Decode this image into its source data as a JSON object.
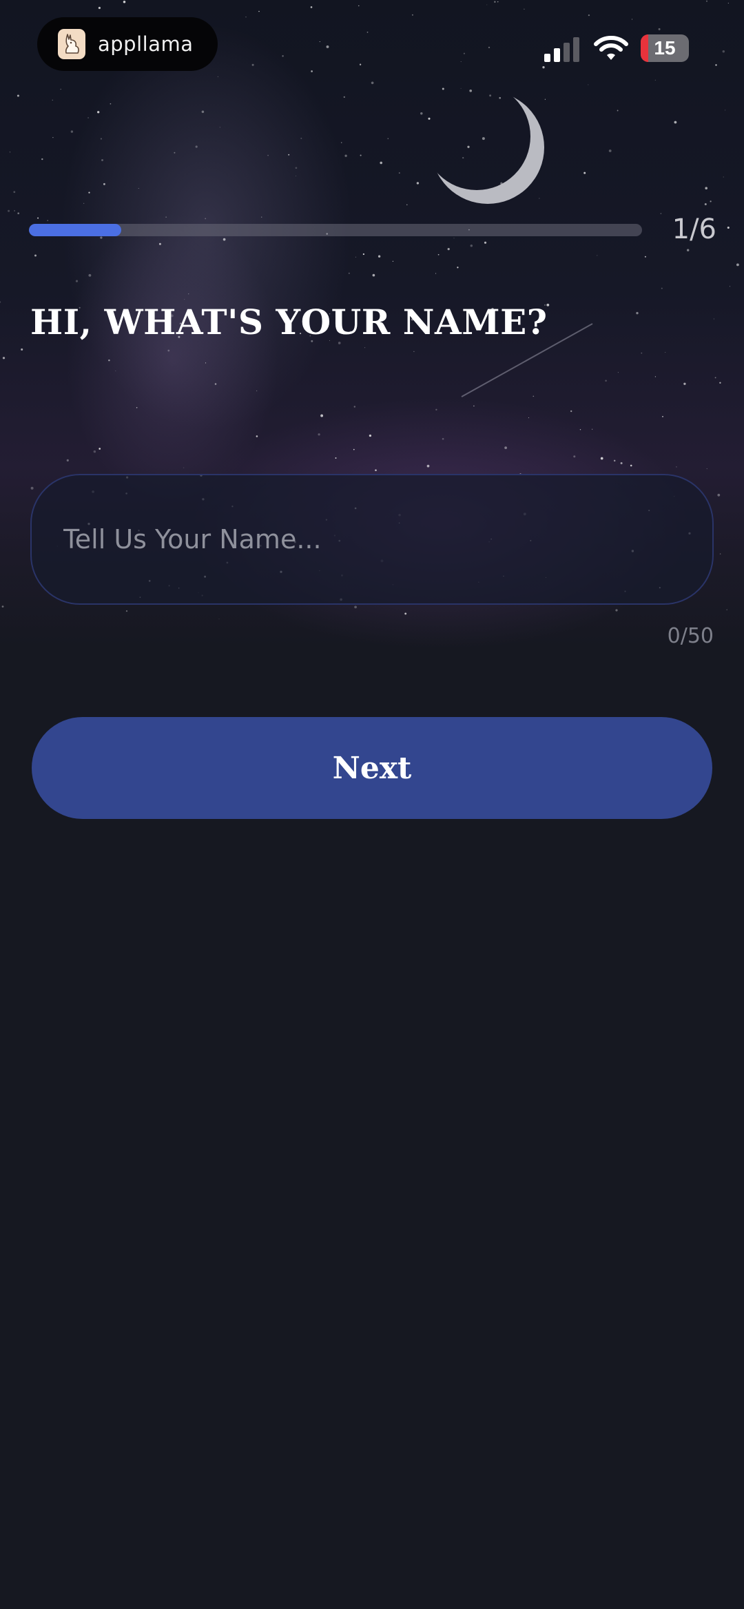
{
  "status_bar": {
    "app_badge_name": "appllama",
    "battery_level": "15",
    "battery_percent": 15
  },
  "progress": {
    "text": "1/6",
    "current_step": 1,
    "total_steps": 6,
    "fill_fraction": 0.15
  },
  "question": {
    "title": "HI, WHAT'S YOUR NAME?"
  },
  "name_input": {
    "placeholder": "Tell Us Your Name...",
    "value": "",
    "counter": "0/50"
  },
  "next_button": {
    "label": "Next"
  },
  "colors": {
    "background": "#161821",
    "accent": "#4b6fe3",
    "button": "#33468f",
    "battery_low": "#e8333c"
  },
  "icons": [
    "llama-logo-icon",
    "cellular-signal-icon",
    "wifi-icon",
    "battery-icon",
    "moon-icon"
  ]
}
